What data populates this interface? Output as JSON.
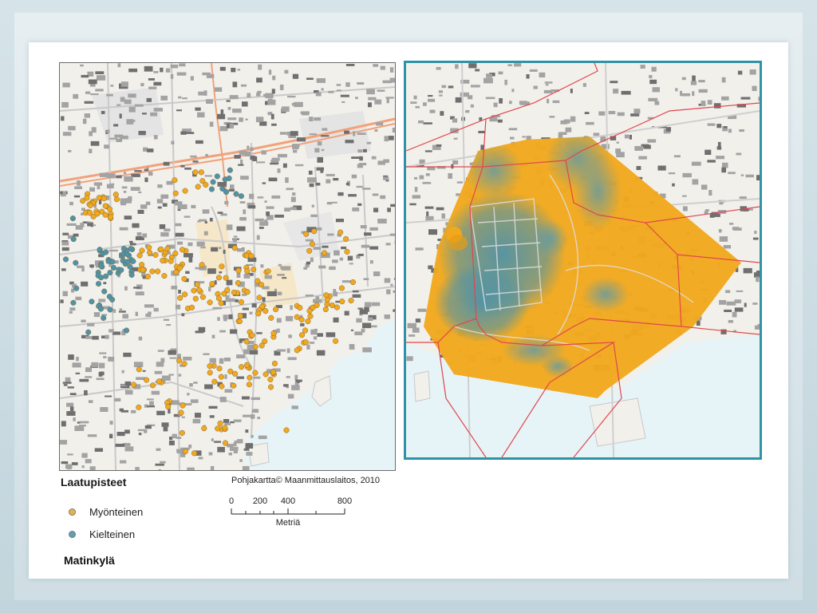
{
  "legend": {
    "title": "Laatupisteet",
    "items": [
      {
        "label": "Myönteinen",
        "color": "#e8b24a"
      },
      {
        "label": "Kielteinen",
        "color": "#5fa0b3"
      }
    ]
  },
  "credit": "Pohjakartta© Maanmittauslaitos, 2010",
  "scale": {
    "ticks": [
      "0",
      "200",
      "400",
      "800"
    ],
    "unit": "Metriä"
  },
  "place_name": "Matinkylä",
  "colors": {
    "positive": "#f2a81d",
    "negative": "#4f93a8",
    "frame": "#2f93a8",
    "boundary": "#e0464e",
    "water": "#e6f4f7"
  }
}
